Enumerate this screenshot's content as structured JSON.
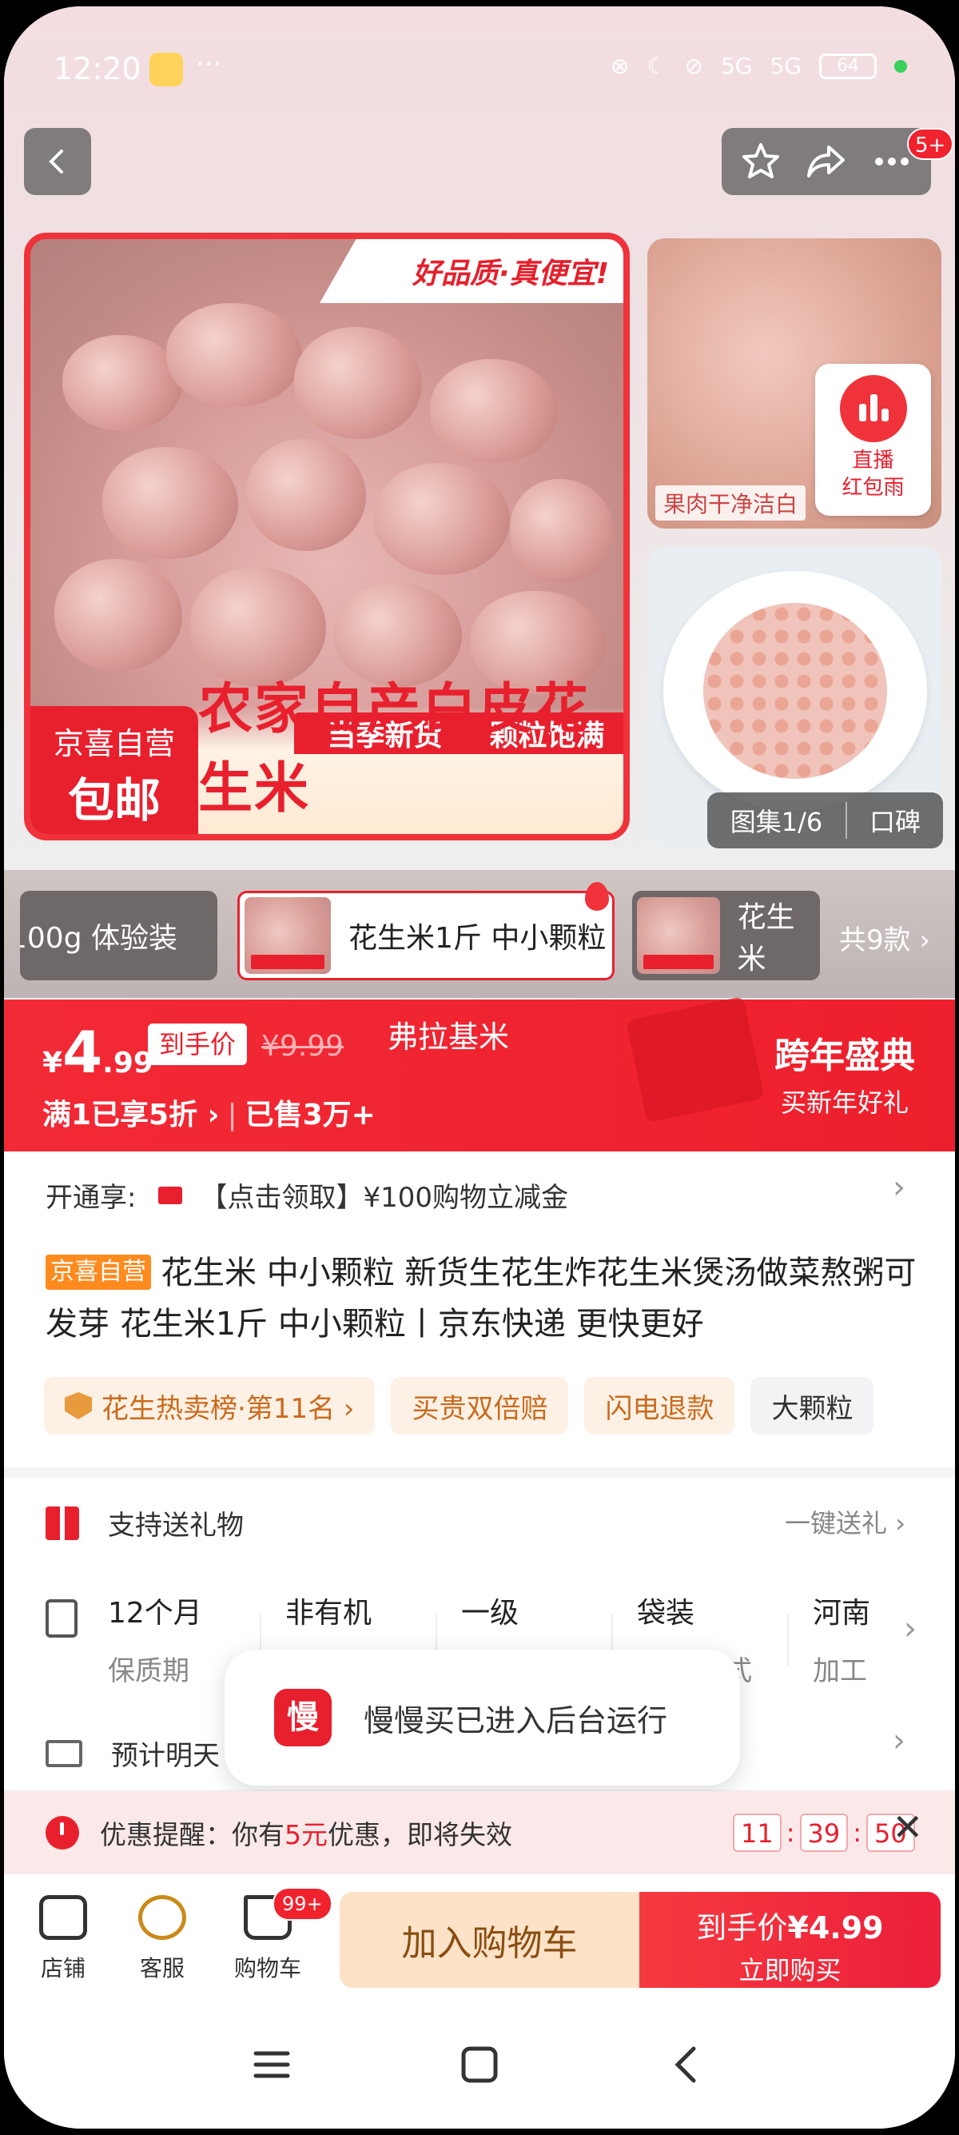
{
  "status_bar": {
    "time": "12:20",
    "dots": "···",
    "network": "5G",
    "battery": "64"
  },
  "header": {
    "more_badge": "5+"
  },
  "gallery": {
    "main_image": {
      "headline": "好品质·真便宜!",
      "band_left": "当季新货",
      "band_right": "颗粒饱满",
      "title": "农家自产白皮花生米",
      "self_tag_line1": "京喜自营",
      "self_tag_line2": "包邮"
    },
    "side_image_caption": "果肉干净洁白",
    "live": {
      "line1": "直播",
      "line2": "红包雨"
    },
    "counter": "图集1/6",
    "reviews_label": "口碑"
  },
  "variants": {
    "items": [
      {
        "label": "100g 体验装"
      },
      {
        "label": "花生米1斤 中小颗粒"
      },
      {
        "label": "花生米"
      }
    ],
    "total": "共9款 ›"
  },
  "price": {
    "currency": "¥",
    "integer": "4",
    "decimal": ".99",
    "net_label": "到手价",
    "original": "¥9.99",
    "overlay_text": "弗拉基米",
    "discount": "满1已享5折 ›",
    "sold": "已售3万+",
    "promo_title": "跨年盛典",
    "promo_sub": "买新年好礼"
  },
  "membership": {
    "label": "开通享:",
    "offer": "【点击领取】¥100购物立减金"
  },
  "product": {
    "tag": "京喜自营",
    "title": "花生米 中小颗粒 新货生花生炸花生米煲汤做菜熬粥可发芽 花生米1斤 中小颗粒丨京东快递 更快更好"
  },
  "chips": [
    "花生热卖榜·第11名 ›",
    "买贵双倍赔",
    "闪电退款",
    "大颗粒"
  ],
  "service": {
    "gift_label": "支持送礼物",
    "gift_action": "一键送礼 ›",
    "attributes": [
      {
        "value": "12个月",
        "key": "保质期"
      },
      {
        "value": "非有机",
        "key": ""
      },
      {
        "value": "一级",
        "key": ""
      },
      {
        "value": "袋装",
        "key": "式"
      },
      {
        "value": "河南",
        "key": "加工"
      }
    ],
    "shipping": "预计明天"
  },
  "toast": {
    "icon_text": "慢",
    "message": "慢慢买已进入后台运行"
  },
  "reminder": {
    "prefix": "优惠提醒：你有",
    "amount": "5元",
    "suffix": "优惠，即将失效",
    "hours": "11",
    "minutes": "39",
    "seconds": "50"
  },
  "bottom_bar": {
    "shop": "店铺",
    "service": "客服",
    "cart": "购物车",
    "cart_badge": "99+",
    "add_to_cart": "加入购物车",
    "buy_price_label": "到手价",
    "buy_price": "¥4.99",
    "buy_now": "立即购买"
  },
  "colors": {
    "brand_red": "#e8202e",
    "accent_orange": "#ff8a1e"
  }
}
